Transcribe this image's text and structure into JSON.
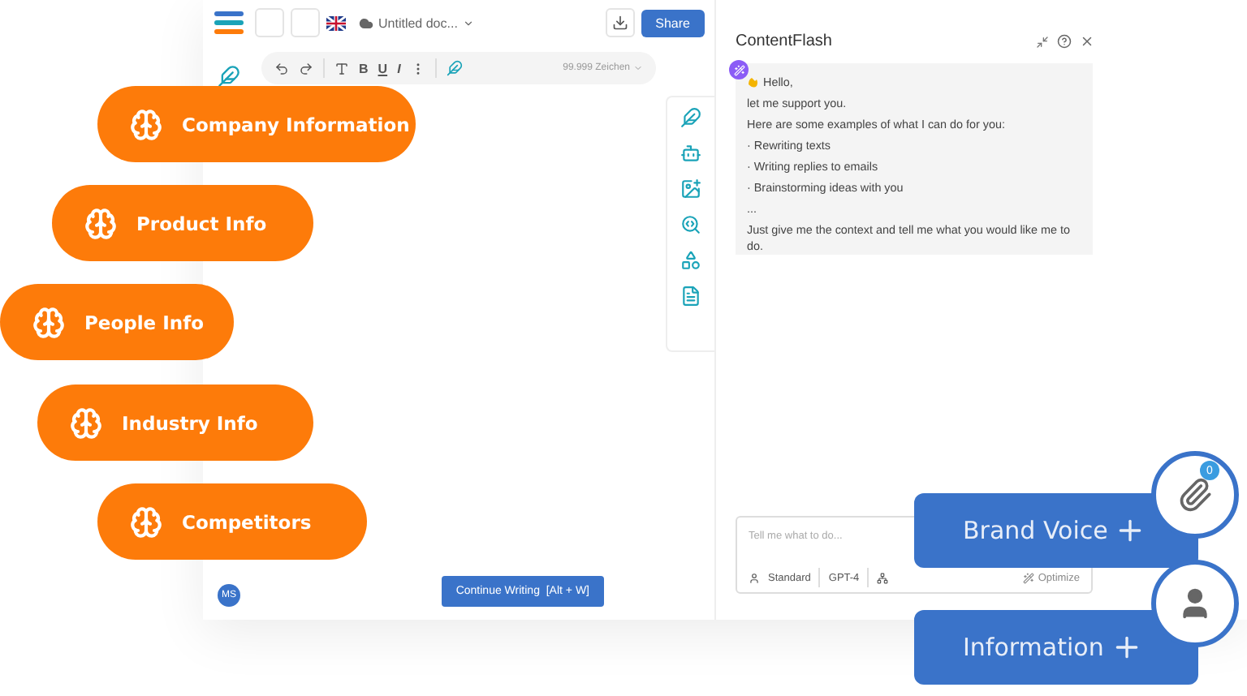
{
  "topbar": {
    "document_title": "Untitled doc...",
    "share": "Share"
  },
  "toolbar": {
    "bold": "B",
    "underline": "U",
    "italic": "I",
    "limit": "99.999 Zeichen"
  },
  "user": {
    "initials": "MS"
  },
  "continue_button": "Continue Writing  [Alt + W]",
  "chat": {
    "title": "ContentFlash",
    "message": [
      "Hello,",
      "let me support you.",
      "Here are some examples of what I can do for you:",
      "· Rewriting texts",
      "· Writing replies to emails",
      "· Brainstorming ideas with you",
      "...",
      "Just give me the context and tell me what you would like me to do."
    ],
    "input": {
      "placeholder": "Tell me what to do...",
      "style": "Standard",
      "model": "GPT-4",
      "optimize": "Optimize"
    }
  },
  "knowledge_pills": [
    {
      "label": "Company Information"
    },
    {
      "label": "Product Info"
    },
    {
      "label": "People Info"
    },
    {
      "label": "Industry Info"
    },
    {
      "label": "Competitors"
    }
  ],
  "feature_buttons": [
    {
      "label": "Brand Voice",
      "kind": "attachment",
      "badge": "0"
    },
    {
      "label": "Information",
      "kind": "person"
    }
  ]
}
